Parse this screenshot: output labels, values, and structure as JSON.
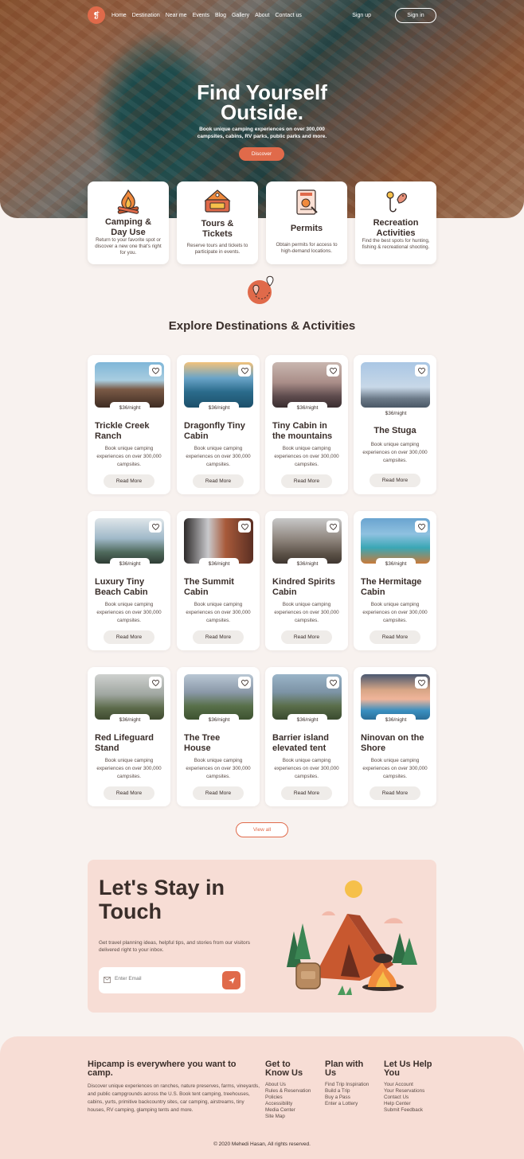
{
  "nav": {
    "logo_glyph": "❡",
    "links": [
      "Home",
      "Destination",
      "Near me",
      "Events",
      "Blog",
      "Gallery",
      "About",
      "Contact us"
    ],
    "signup": "Sign up",
    "signin": "Sign in"
  },
  "hero": {
    "title_line1": "Find Yourself",
    "title_line2": "Outside.",
    "subtitle": "Book unique camping experiences on over 300,000 campsites, cabins, RV parks, public parks and more.",
    "button": "Discover"
  },
  "services": [
    {
      "icon": "campfire-icon",
      "title_l1": "Camping &",
      "title_l2": "Day Use",
      "desc": "Return to your favorite spot or discover a new one that's right for you."
    },
    {
      "icon": "ticket-icon",
      "title_l1": "Tours &",
      "title_l2": "Tickets",
      "desc": "Reserve tours and tickets to participate in events."
    },
    {
      "icon": "permit-document-icon",
      "title_l1": "Permits",
      "title_l2": "",
      "desc": "Obtain permits for access to high-demand locations."
    },
    {
      "icon": "fishing-hook-icon",
      "title_l1": "Recreation",
      "title_l2": "Activities",
      "desc": "Find the best spots for hunting, fishing & recreational shooting."
    }
  ],
  "section_title": "Explore Destinations & Activities",
  "cards": [
    {
      "title_l1": "Trickle Creek",
      "title_l2": "Ranch",
      "price": "$36/night",
      "desc": "Book unique camping experiences on over 300,000 campsites.",
      "cta": "Read More",
      "scene": "balcony"
    },
    {
      "title_l1": "Dragonfly Tiny",
      "title_l2": "Cabin",
      "price": "$36/night",
      "desc": "Book unique camping experiences on over 300,000 campsites.",
      "cta": "Read More",
      "scene": "sunset-sea"
    },
    {
      "title_l1": "Tiny Cabin in",
      "title_l2": "the mountains",
      "price": "$36/night",
      "desc": "Book unique camping experiences on over 300,000 campsites.",
      "cta": "Read More",
      "scene": "balloons"
    },
    {
      "title_l1": "The Stuga",
      "title_l2": "",
      "price": "$36/night",
      "desc": "Book unique camping experiences on over 300,000 campsites.",
      "cta": "Read More",
      "scene": "lighthouse"
    },
    {
      "title_l1": "Luxury Tiny",
      "title_l2": "Beach Cabin",
      "price": "$36/night",
      "desc": "Book unique camping experiences on over 300,000 campsites.",
      "cta": "Read More",
      "scene": "tent-view"
    },
    {
      "title_l1": "The Summit",
      "title_l2": "Cabin",
      "price": "$36/night",
      "desc": "Book unique camping experiences on over 300,000 campsites.",
      "cta": "Read More",
      "scene": "waterfall"
    },
    {
      "title_l1": "Kindred Spirits",
      "title_l2": "Cabin",
      "price": "$36/night",
      "desc": "Book unique camping experiences on over 300,000 campsites.",
      "cta": "Read More",
      "scene": "viaduct"
    },
    {
      "title_l1": "The Hermitage",
      "title_l2": "Cabin",
      "price": "$36/night",
      "desc": "Book unique camping experiences on over 300,000 campsites.",
      "cta": "Read More",
      "scene": "lake"
    },
    {
      "title_l1": "Red Lifeguard",
      "title_l2": "Stand",
      "price": "$36/night",
      "desc": "Book unique camping experiences on over 300,000 campsites.",
      "cta": "Read More",
      "scene": "hills"
    },
    {
      "title_l1": "The Tree",
      "title_l2": "House",
      "price": "$36/night",
      "desc": "Book unique camping experiences on over 300,000 campsites.",
      "cta": "Read More",
      "scene": "meadow"
    },
    {
      "title_l1": "Barrier island",
      "title_l2": "elevated tent",
      "price": "$36/night",
      "desc": "Book unique camping experiences on over 300,000 campsites.",
      "cta": "Read More",
      "scene": "valley"
    },
    {
      "title_l1": "Ninovan on the",
      "title_l2": "Shore",
      "price": "$36/night",
      "desc": "Book unique camping experiences on over 300,000 campsites.",
      "cta": "Read More",
      "scene": "pool"
    }
  ],
  "view_all": "View all",
  "newsletter": {
    "title_l1": "Let's Stay in",
    "title_l2": "Touch",
    "subtitle": "Get travel planning ideas, helpful tips, and stories from our visitors delivered right to your inbox.",
    "email_placeholder": "Enter Email"
  },
  "footer": {
    "about_title": "Hipcamp is everywhere you want to camp.",
    "about_desc": "Discover unique experiences on ranches, nature preserves, farms, vineyards, and public campgrounds across the U.S. Book tent camping, treehouses, cabins, yurts, primitive backcountry sites, car camping, airstreams, tiny houses, RV camping, glamping tents and more.",
    "cols": [
      {
        "title_l1": "Get to",
        "title_l2": "Know Us",
        "links": [
          "About Us",
          "Rules & Reservation",
          "Policies",
          "Accessibility",
          "Media Center",
          "Site Map"
        ]
      },
      {
        "title_l1": "Plan with",
        "title_l2": "Us",
        "links": [
          "Find Trip Inspiration",
          "Build a Trip",
          "Buy a Pass",
          "Enter a Lottery"
        ]
      },
      {
        "title_l1": "Let Us Help",
        "title_l2": "You",
        "links": [
          "Your Account",
          "Your Reservations",
          "Contact Us",
          "Help Center",
          "Submit Feedback"
        ]
      }
    ],
    "copyright": "© 2020 Mehedi Hasan, All rights reserved."
  },
  "colors": {
    "accent": "#e06a4a",
    "background": "#f8f2ef",
    "panel": "#f7ddd5",
    "text": "#3a2e2a"
  }
}
